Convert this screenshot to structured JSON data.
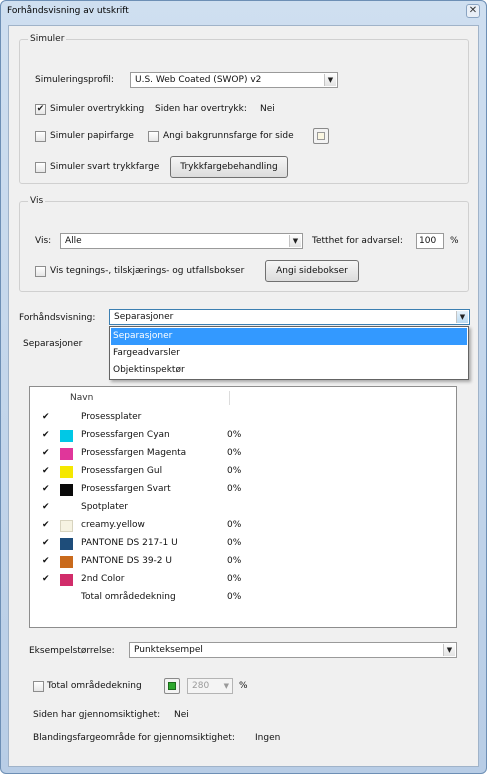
{
  "window": {
    "title": "Forhåndsvisning av utskrift",
    "close_glyph": "✕"
  },
  "simulate": {
    "group_title": "Simuler",
    "profile_label": "Simuleringsprofil:",
    "profile_value": "U.S. Web Coated (SWOP) v2",
    "overprint_label": "Simuler overtrykking",
    "overprint_checked": true,
    "page_has_overprint_label": "Siden har overtrykk:",
    "page_has_overprint_value": "Nei",
    "paper_color_label": "Simuler papirfarge",
    "bg_color_label": "Angi bakgrunnsfarge for side",
    "bg_color_value": "#fbf7e2",
    "black_ink_label": "Simuler svart trykkfarge",
    "ink_manager_button": "Trykkfargebehandling"
  },
  "show": {
    "group_title": "Vis",
    "show_label": "Vis:",
    "show_value": "Alle",
    "density_label": "Tetthet for advarsel:",
    "density_value": "100",
    "density_unit": "%",
    "boxes_label": "Vis tegnings-, tilskjærings- og utfallsbokser",
    "page_boxes_button": "Angi sidebokser"
  },
  "preview": {
    "label": "Forhåndsvisning:",
    "value": "Separasjoner",
    "options": [
      "Separasjoner",
      "Fargeadvarsler",
      "Objektinspektør"
    ],
    "selected_index": 0
  },
  "separations": {
    "section_title": "Separasjoner",
    "column_name": "Navn",
    "rows": [
      {
        "name": "Prosessplater",
        "checked": true,
        "color": "",
        "pct": ""
      },
      {
        "name": "Prosessfargen Cyan",
        "checked": true,
        "color": "#00c8e6",
        "pct": "0%"
      },
      {
        "name": "Prosessfargen Magenta",
        "checked": true,
        "color": "#e0369a",
        "pct": "0%"
      },
      {
        "name": "Prosessfargen Gul",
        "checked": true,
        "color": "#f5e800",
        "pct": "0%"
      },
      {
        "name": "Prosessfargen Svart",
        "checked": true,
        "color": "#0a0a0a",
        "pct": "0%"
      },
      {
        "name": "Spotplater",
        "checked": true,
        "color": "",
        "pct": ""
      },
      {
        "name": "creamy.yellow",
        "checked": true,
        "color": "#f6f3e2",
        "pct": "0%"
      },
      {
        "name": "PANTONE DS 217-1 U",
        "checked": true,
        "color": "#1e4d7a",
        "pct": "0%"
      },
      {
        "name": "PANTONE DS 39-2 U",
        "checked": true,
        "color": "#c96a1c",
        "pct": "0%"
      },
      {
        "name": "2nd Color",
        "checked": true,
        "color": "#d12c6a",
        "pct": "0%"
      },
      {
        "name": "Total områdedekning",
        "checked": false,
        "color": "",
        "pct": "0%"
      }
    ],
    "check_glyph": "✔"
  },
  "sample": {
    "size_label": "Eksempelstørrelse:",
    "size_value": "Punkteksempel",
    "total_coverage_label": "Total områdedekning",
    "total_coverage_color": "#2ea82e",
    "total_coverage_value": "280",
    "total_coverage_unit": "%",
    "transparency_label": "Siden har gjennomsiktighet:",
    "transparency_value": "Nei",
    "blend_label": "Blandingsfargeområde for gjennomsiktighet:",
    "blend_value": "Ingen"
  }
}
